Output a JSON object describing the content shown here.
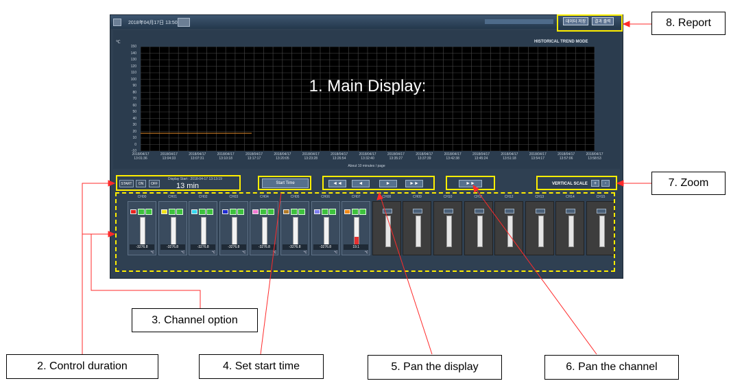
{
  "titlebar": {
    "datetime": "2018年04月17日 13:50:34"
  },
  "report": {
    "btn1": "데이터 저장",
    "btn2": "결과 출력"
  },
  "plot": {
    "unit": "℃",
    "mode": "HISTORICAL TREND MODE",
    "overlay_title": "1. Main Display:",
    "yticks": [
      "150",
      "140",
      "130",
      "120",
      "110",
      "100",
      "90",
      "80",
      "70",
      "60",
      "50",
      "40",
      "30",
      "20",
      "10",
      "0",
      "-10"
    ],
    "xticks": [
      [
        "2018/04/17",
        "13:01:36"
      ],
      [
        "2018/04/17",
        "13:04:33"
      ],
      [
        "2018/04/17",
        "13:07:31"
      ],
      [
        "2018/04/17",
        "13:10:18"
      ],
      [
        "2018/04/17",
        "13:17:17"
      ],
      [
        "2018/04/17",
        "13:20:05"
      ],
      [
        "2018/04/17",
        "13:23:28"
      ],
      [
        "2018/04/17",
        "13:26:54"
      ],
      [
        "2018/04/17",
        "13:32:40"
      ],
      [
        "2018/04/17",
        "13:35:27"
      ],
      [
        "2018/04/17",
        "13:37:39"
      ],
      [
        "2018/04/17",
        "13:42:38"
      ],
      [
        "2018/04/17",
        "13:45:24"
      ],
      [
        "2018/04/17",
        "13:51:18"
      ],
      [
        "2018/04/17",
        "13:54:17"
      ],
      [
        "2018/04/17",
        "13:57:06"
      ],
      [
        "2018/04/17",
        "13:58:53"
      ]
    ],
    "footer": "About 10 minutes / page"
  },
  "controls": {
    "start_label": "START",
    "on_label": "ON",
    "off_label": "OFF",
    "display_start": "Display Start : 2018-04-17 13:13:19",
    "duration": "13 min",
    "start_time": "Start Time",
    "nav": [
      "◄◄",
      "◄",
      "►",
      "►►"
    ],
    "pan_channel": "►►",
    "vertical_scale": "VERTICAL SCALE",
    "zoom_in": "+",
    "zoom_out": "-"
  },
  "channels": [
    {
      "name": "CH00",
      "color": "#e8231f",
      "value": "-3276.8",
      "unit": "℃"
    },
    {
      "name": "CH01",
      "color": "#f2e21a",
      "value": "-3276.8",
      "unit": "℃"
    },
    {
      "name": "CH02",
      "color": "#35d7f0",
      "value": "-3276.8",
      "unit": "℃"
    },
    {
      "name": "CH03",
      "color": "#1f2bd0",
      "value": "-3276.8",
      "unit": "℃"
    },
    {
      "name": "CH04",
      "color": "#f07ad2",
      "value": "-3276.8",
      "unit": "℃"
    },
    {
      "name": "CH05",
      "color": "#b07a2a",
      "value": "-3276.8",
      "unit": "℃"
    },
    {
      "name": "CH06",
      "color": "#7f7ff0",
      "value": "-3276.8",
      "unit": "℃"
    },
    {
      "name": "CH07",
      "color": "#f08a1a",
      "value": "19.1",
      "unit": "℃"
    },
    {
      "name": "CH08"
    },
    {
      "name": "CH09"
    },
    {
      "name": "CH10"
    },
    {
      "name": "CH11"
    },
    {
      "name": "CH12"
    },
    {
      "name": "CH13"
    },
    {
      "name": "CH14"
    },
    {
      "name": "CH15"
    }
  ],
  "callouts": {
    "report": "8. Report",
    "zoom": "7. Zoom",
    "channel_option": "3. Channel option",
    "control_duration": "2. Control duration",
    "start_time": "4. Set start time",
    "pan_display": "5. Pan the display",
    "pan_channel": "6. Pan the channel"
  }
}
